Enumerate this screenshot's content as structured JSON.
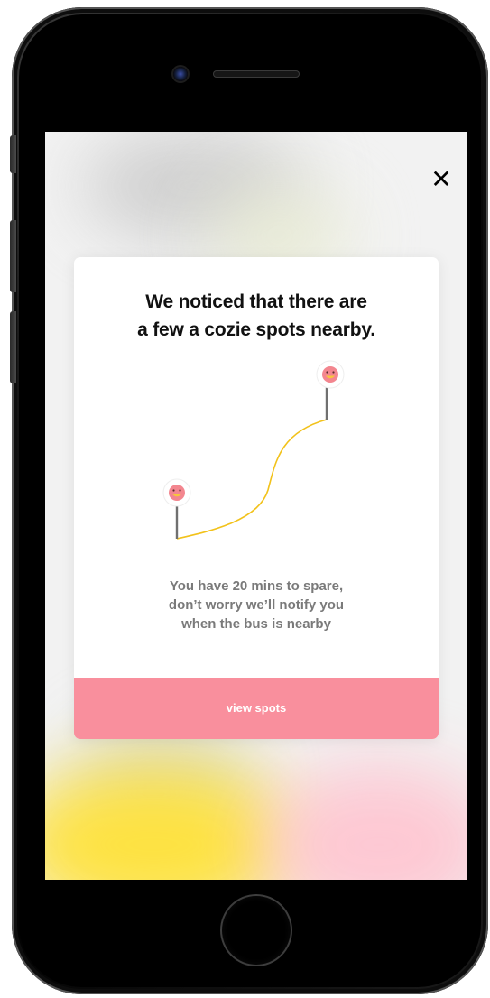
{
  "modal": {
    "close_icon": "close-icon",
    "title_lines": [
      "We noticed that there are",
      "a few a cozie spots nearby."
    ],
    "body_lines": [
      "You have 20 mins to spare,",
      "don’t worry we’ll notify you",
      "when the bus is nearby"
    ],
    "cta_label": "view spots"
  },
  "illustration": {
    "start_marker_icon": "smiley-pin-icon",
    "end_marker_icon": "smiley-pin-icon",
    "route_color": "#f2c21b"
  },
  "colors": {
    "accent": "#f98f9d",
    "title_text": "#111111",
    "body_text": "#7a7a7a"
  }
}
